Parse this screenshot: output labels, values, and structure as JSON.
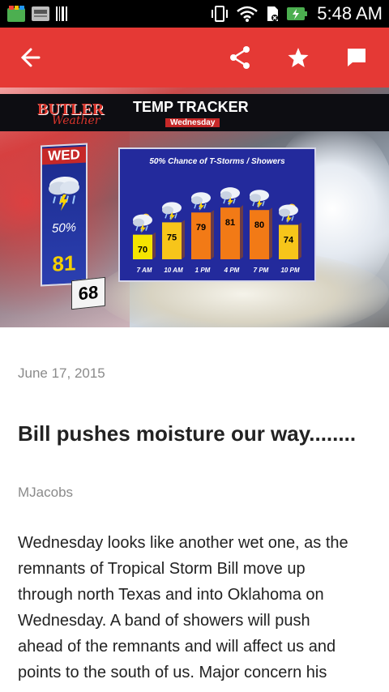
{
  "status_bar": {
    "time": "5:48 AM",
    "icons": [
      "app-icon",
      "news-app-icon",
      "barcode-icon",
      "vibrate-icon",
      "wifi-icon",
      "sim-icon",
      "battery-charging-icon"
    ]
  },
  "toolbar": {
    "background": "#e53935",
    "icons": [
      "back-arrow-icon",
      "share-icon",
      "star-icon",
      "comment-icon"
    ]
  },
  "hero_image": {
    "logo_main": "BUTLER",
    "logo_sub": "Weather",
    "title": "TEMP TRACKER",
    "subtitle": "Wednesday",
    "day": "WED",
    "precip_chance": "50%",
    "high": "81",
    "low": "68",
    "chart_caption": "50% Chance of T-Storms / Showers"
  },
  "chart_data": {
    "type": "bar",
    "title": "50% Chance of T-Storms / Showers",
    "categories": [
      "7 AM",
      "10 AM",
      "1 PM",
      "4 PM",
      "7 PM",
      "10 PM"
    ],
    "values": [
      70,
      75,
      79,
      81,
      80,
      74
    ],
    "colors": [
      "#f5e400",
      "#f7c51a",
      "#f27a16",
      "#f27a16",
      "#f27a16",
      "#f7c51a"
    ],
    "xlabel": "",
    "ylabel": "",
    "ylim": [
      60,
      85
    ],
    "grid": false
  },
  "article": {
    "date": "June 17, 2015",
    "title": "Bill pushes moisture our way........",
    "author": "MJacobs",
    "body_lines": [
      "Wednesday looks like another wet one, as the",
      "remnants of Tropical Storm Bill move up",
      "through north Texas and into Oklahoma on",
      "Wednesday.  A band of showers will push",
      "ahead of the remnants and will affect us and",
      "points to the south of us.  Major concern his"
    ]
  }
}
